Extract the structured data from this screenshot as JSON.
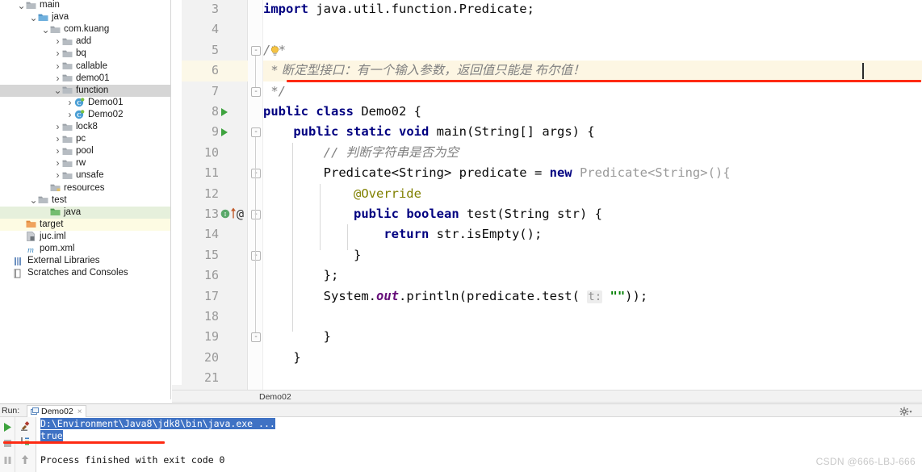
{
  "project_tree": [
    {
      "label": "main",
      "depth": 1,
      "arrow": "down",
      "icon": "folder-module",
      "state": "none"
    },
    {
      "label": "java",
      "depth": 2,
      "arrow": "down",
      "icon": "folder-source",
      "state": "none"
    },
    {
      "label": "com.kuang",
      "depth": 3,
      "arrow": "down",
      "icon": "folder-package",
      "state": "none"
    },
    {
      "label": "add",
      "depth": 4,
      "arrow": "right",
      "icon": "folder-package",
      "state": "none"
    },
    {
      "label": "bq",
      "depth": 4,
      "arrow": "right",
      "icon": "folder-package",
      "state": "none"
    },
    {
      "label": "callable",
      "depth": 4,
      "arrow": "right",
      "icon": "folder-package",
      "state": "none"
    },
    {
      "label": "demo01",
      "depth": 4,
      "arrow": "right",
      "icon": "folder-package",
      "state": "none"
    },
    {
      "label": "function",
      "depth": 4,
      "arrow": "down",
      "icon": "folder-package",
      "state": "selected"
    },
    {
      "label": "Demo01",
      "depth": 5,
      "arrow": "right",
      "icon": "java-class",
      "state": "none"
    },
    {
      "label": "Demo02",
      "depth": 5,
      "arrow": "right",
      "icon": "java-class",
      "state": "none"
    },
    {
      "label": "lock8",
      "depth": 4,
      "arrow": "right",
      "icon": "folder-package",
      "state": "none"
    },
    {
      "label": "pc",
      "depth": 4,
      "arrow": "right",
      "icon": "folder-package",
      "state": "none"
    },
    {
      "label": "pool",
      "depth": 4,
      "arrow": "right",
      "icon": "folder-package",
      "state": "none"
    },
    {
      "label": "rw",
      "depth": 4,
      "arrow": "right",
      "icon": "folder-package",
      "state": "none"
    },
    {
      "label": "unsafe",
      "depth": 4,
      "arrow": "right",
      "icon": "folder-package",
      "state": "none"
    },
    {
      "label": "resources",
      "depth": 3,
      "arrow": "none",
      "icon": "folder-resources",
      "state": "none"
    },
    {
      "label": "test",
      "depth": 2,
      "arrow": "down",
      "icon": "folder-test",
      "state": "none"
    },
    {
      "label": "java",
      "depth": 3,
      "arrow": "none",
      "icon": "folder-test-source",
      "state": "green"
    },
    {
      "label": "target",
      "depth": 1,
      "arrow": "none",
      "icon": "folder-target",
      "state": "yellow"
    },
    {
      "label": "juc.iml",
      "depth": 1,
      "arrow": "none",
      "icon": "iml-file",
      "state": "none"
    },
    {
      "label": "pom.xml",
      "depth": 1,
      "arrow": "none",
      "icon": "maven-file",
      "state": "none"
    },
    {
      "label": "External Libraries",
      "depth": 0,
      "arrow": "none",
      "icon": "library-icon",
      "state": "none"
    },
    {
      "label": "Scratches and Consoles",
      "depth": 0,
      "arrow": "none",
      "icon": "scratch-icon",
      "state": "none"
    }
  ],
  "editor": {
    "first_visible_line": 3,
    "lines": [
      {
        "n": 3,
        "text": "import java.util.function.Predicate;"
      },
      {
        "n": 4,
        "text": ""
      },
      {
        "n": 5,
        "text": "/**"
      },
      {
        "n": 6,
        "text": " * 断定型接口：有一个输入参数，返回值只能是 布尔值！"
      },
      {
        "n": 7,
        "text": " */"
      },
      {
        "n": 8,
        "text": "public class Demo02 {"
      },
      {
        "n": 9,
        "text": "    public static void main(String[] args) {"
      },
      {
        "n": 10,
        "text": "        // 判断字符串是否为空"
      },
      {
        "n": 11,
        "text": "        Predicate<String> predicate = new Predicate<String>(){"
      },
      {
        "n": 12,
        "text": "            @Override"
      },
      {
        "n": 13,
        "text": "            public boolean test(String str) {"
      },
      {
        "n": 14,
        "text": "                return str.isEmpty();"
      },
      {
        "n": 15,
        "text": "            }"
      },
      {
        "n": 16,
        "text": "        };"
      },
      {
        "n": 17,
        "text": "        System.out.println(predicate.test( t: \"\"));"
      },
      {
        "n": 18,
        "text": ""
      },
      {
        "n": 19,
        "text": "        }"
      },
      {
        "n": 20,
        "text": "    }"
      },
      {
        "n": 21,
        "text": ""
      }
    ],
    "current_line": 6,
    "param_hint": "t:",
    "gutter_icons": {
      "line8": "run-class-icon",
      "line9": "run-method-icon",
      "line13": "implementing-method-icon",
      "line13_override": "override-arrow-icon",
      "line13_annotation": "@",
      "line5": "intention-bulb-icon"
    },
    "breadcrumb": "Demo02"
  },
  "run_panel": {
    "run_label": "Run:",
    "tab_title": "Demo02",
    "tab_close": "×",
    "gear_icon": "gear-icon",
    "console_lines": [
      {
        "text": "D:\\Environment\\Java8\\jdk8\\bin\\java.exe ...",
        "selected": true
      },
      {
        "text": "true",
        "selected": true
      },
      {
        "text": "",
        "selected": false
      },
      {
        "text": "Process finished with exit code 0",
        "selected": false
      }
    ],
    "toolbar_left": [
      "run-icon",
      "stop-icon",
      "pause-icon"
    ],
    "toolbar_right": [
      "rerun-icon",
      "scroll-to-end-icon",
      "up-arrow-icon"
    ]
  },
  "watermark": "CSDN @666-LBJ-666",
  "colors": {
    "keyword": "#000080",
    "comment": "#808080",
    "string": "#008000",
    "annotation": "#808000",
    "highlight_row": "#fdf6e3",
    "selection": "#3f72c4",
    "red_underline": "#fe2a12"
  }
}
